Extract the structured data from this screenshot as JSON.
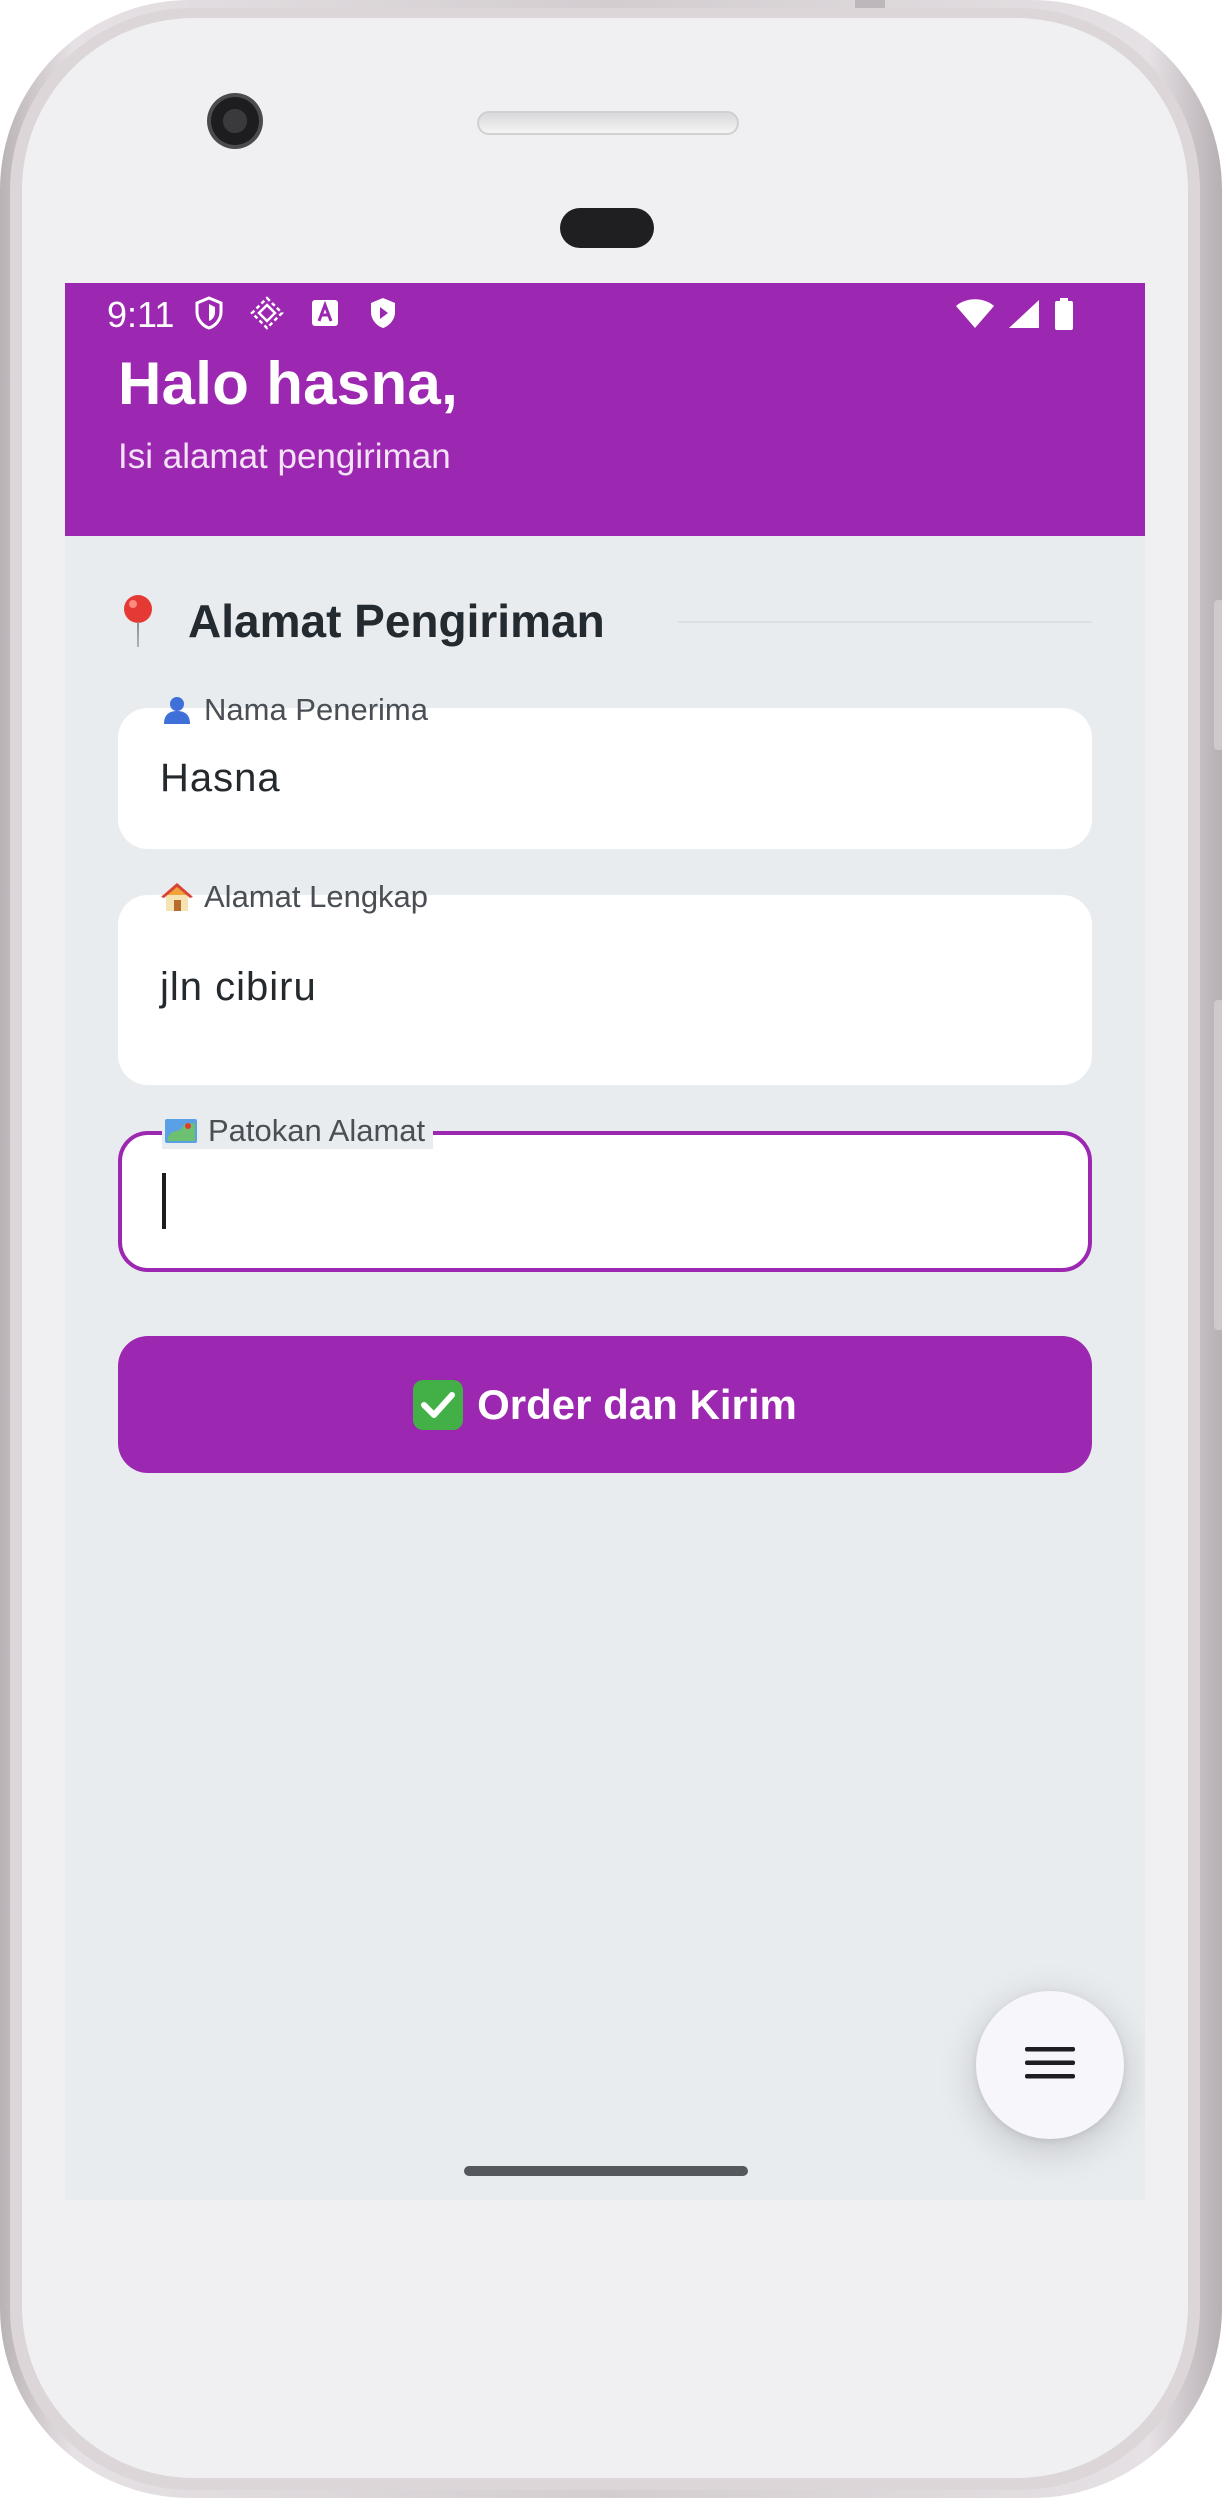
{
  "status_bar": {
    "time": "9:11"
  },
  "header": {
    "title": "Halo hasna,",
    "subtitle": "Isi alamat pengiriman",
    "background_color": "#9c27b0"
  },
  "section": {
    "title": "Alamat Pengiriman",
    "icon": "pin-icon"
  },
  "form": {
    "recipient": {
      "label": "Nama Penerima",
      "icon": "person-icon",
      "value": "Hasna"
    },
    "address": {
      "label": "Alamat Lengkap",
      "icon": "house-icon",
      "value": "jln cibiru"
    },
    "landmark": {
      "label": "Patokan Alamat",
      "icon": "map-icon",
      "value": "",
      "focused": true
    }
  },
  "actions": {
    "order_label": "Order dan Kirim",
    "order_icon": "check-icon",
    "fab_icon": "menu-icon"
  },
  "colors": {
    "accent": "#9c27b0",
    "screen_background": "#e9ecef",
    "field_background": "#ffffff",
    "check_green": "#43b047"
  }
}
